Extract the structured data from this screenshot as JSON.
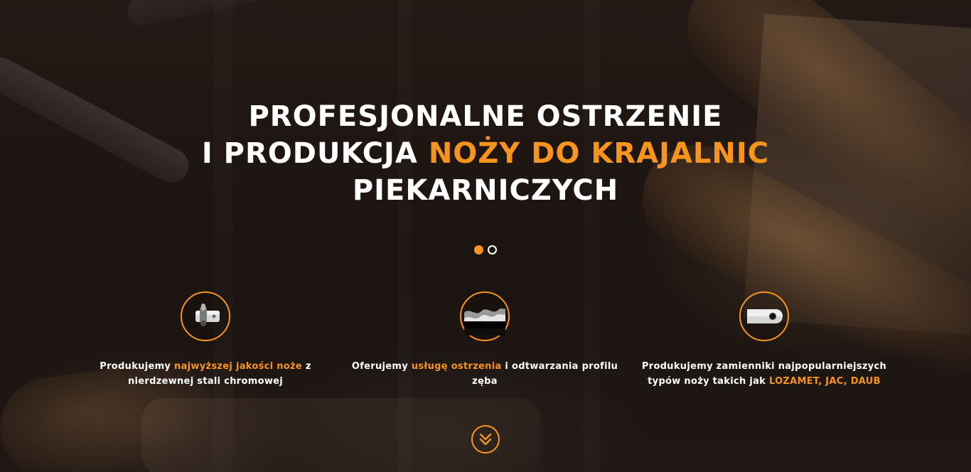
{
  "hero": {
    "title_line1": "PROFESJONALNE OSTRZENIE",
    "title_line2_prefix": "I PRODUKCJA ",
    "title_line2_accent": "NOŻY DO KRAJALNIC",
    "title_line3": "PIEKARNICZYCH",
    "accent_color": "#f7941d"
  },
  "slider": {
    "slides": 2,
    "active": 1
  },
  "features": [
    {
      "icon": "knife-blade-pin-icon",
      "text_before": "Produkujemy ",
      "text_accent": "najwyższej jakości noże",
      "text_after": " z nierdzewnej stali chromowej"
    },
    {
      "icon": "serrated-blade-icon",
      "text_before": "Oferujemy ",
      "text_accent": "usługę ostrzenia",
      "text_after": " i odtwarzania profilu zęba"
    },
    {
      "icon": "replacement-blade-icon",
      "text_before": "Produkujemy zamienniki najpopularniejszych typów noży takich jak ",
      "text_accent": "LOZAMET, JAC, DAUB",
      "text_after": ""
    }
  ],
  "scroll_button": {
    "icon": "double-chevron-down-icon"
  }
}
